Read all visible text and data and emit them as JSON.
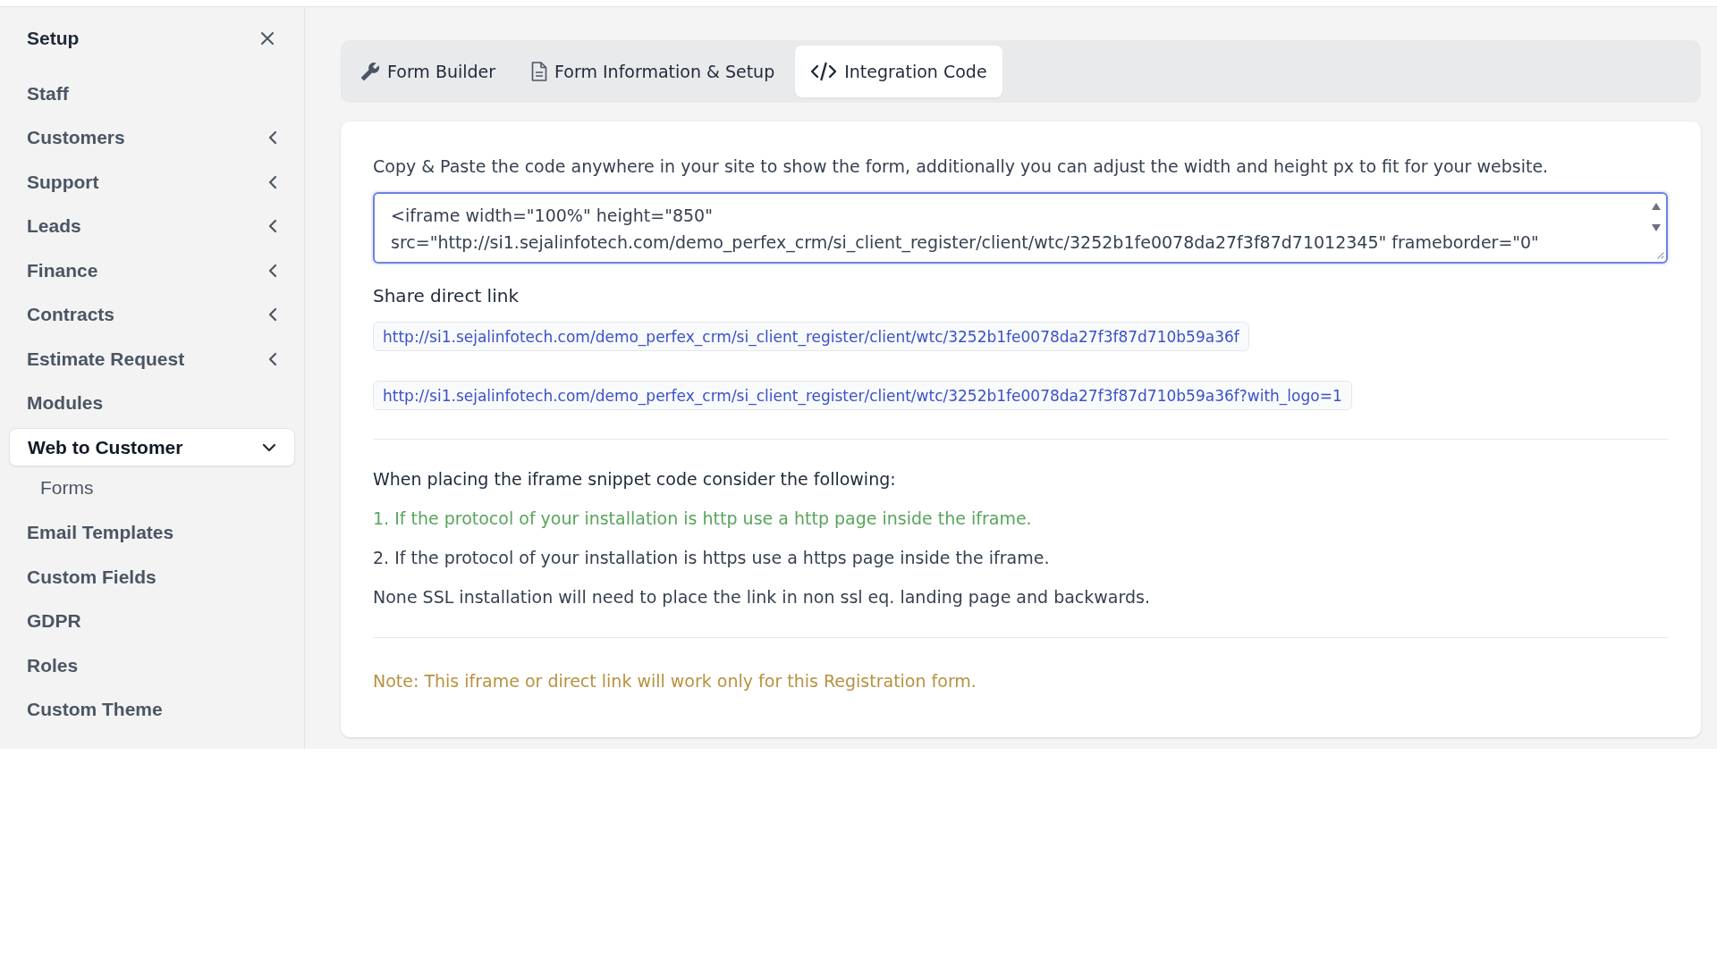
{
  "sidebar": {
    "title": "Setup",
    "items": [
      {
        "label": "Staff",
        "kind": "link",
        "selected": false
      },
      {
        "label": "Customers",
        "kind": "group",
        "expanded": false,
        "selected": false
      },
      {
        "label": "Support",
        "kind": "group",
        "expanded": false,
        "selected": false
      },
      {
        "label": "Leads",
        "kind": "group",
        "expanded": false,
        "selected": false
      },
      {
        "label": "Finance",
        "kind": "group",
        "expanded": false,
        "selected": false
      },
      {
        "label": "Contracts",
        "kind": "group",
        "expanded": false,
        "selected": false
      },
      {
        "label": "Estimate Request",
        "kind": "group",
        "expanded": false,
        "selected": false
      },
      {
        "label": "Modules",
        "kind": "link",
        "selected": false
      },
      {
        "label": "Web to Customer",
        "kind": "group",
        "expanded": true,
        "selected": true,
        "children": [
          {
            "label": "Forms",
            "selected": false
          }
        ]
      },
      {
        "label": "Email Templates",
        "kind": "link",
        "selected": false
      },
      {
        "label": "Custom Fields",
        "kind": "link",
        "selected": false
      },
      {
        "label": "GDPR",
        "kind": "link",
        "selected": false
      },
      {
        "label": "Roles",
        "kind": "link",
        "selected": false
      },
      {
        "label": "Custom Theme",
        "kind": "link",
        "selected": false
      }
    ]
  },
  "tabs": [
    {
      "label": "Form Builder",
      "selected": false
    },
    {
      "label": "Form Information & Setup",
      "selected": false
    },
    {
      "label": "Integration Code",
      "selected": true
    }
  ],
  "integration": {
    "instructions": "Copy & Paste the code anywhere in your site to show the form, additionally you can adjust the width and height px to fit for your website.",
    "code_field": {
      "value": "<iframe width=\"100%\" height=\"850\" src=\"http://si1.sejalinfotech.com/demo_perfex_crm/si_client_register/client/wtc/3252b1fe0078da27f3f87d71012345\" frameborder=\"0\"",
      "focused": true
    },
    "share_heading": "Share direct link",
    "links": [
      "http://si1.sejalinfotech.com/demo_perfex_crm/si_client_register/client/wtc/3252b1fe0078da27f3f87d710b59a36f",
      "http://si1.sejalinfotech.com/demo_perfex_crm/si_client_register/client/wtc/3252b1fe0078da27f3f87d710b59a36f?with_logo=1"
    ],
    "notes_heading": "When placing the iframe snippet code consider the following:",
    "notes": [
      {
        "text": "1. If the protocol of your installation is http use a http page inside the iframe.",
        "kind": "highlight"
      },
      {
        "text": "2. If the protocol of your installation is https use a https page inside the iframe.",
        "kind": "plain"
      },
      {
        "text": "None SSL installation will need to place the link in non ssl eq. landing page and backwards.",
        "kind": "plain"
      }
    ],
    "footnote": "Note: This iframe or direct link will work only for this Registration form."
  }
}
